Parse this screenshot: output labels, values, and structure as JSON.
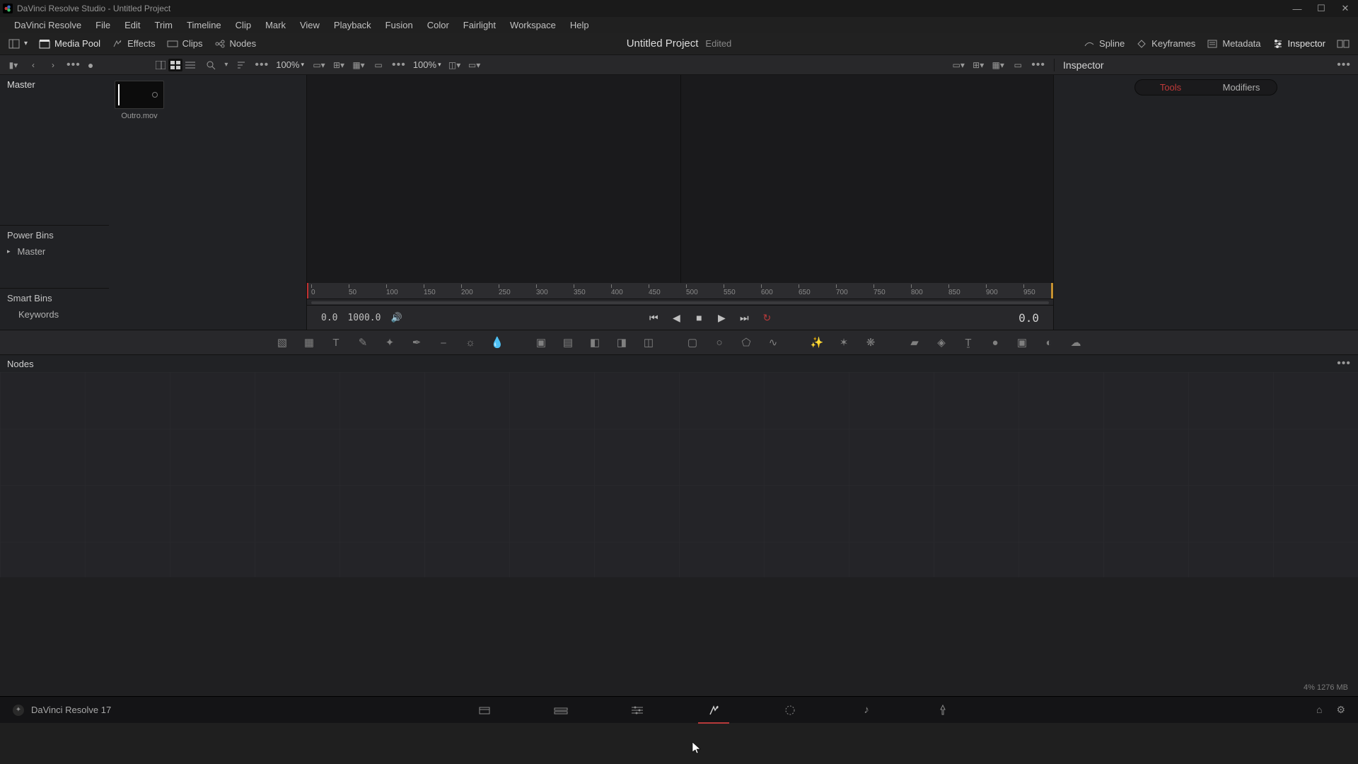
{
  "window_title": "DaVinci Resolve Studio - Untitled Project",
  "menu": [
    "DaVinci Resolve",
    "File",
    "Edit",
    "Trim",
    "Timeline",
    "Clip",
    "Mark",
    "View",
    "Playback",
    "Fusion",
    "Color",
    "Fairlight",
    "Workspace",
    "Help"
  ],
  "toolbar": {
    "media_pool": "Media Pool",
    "effects": "Effects",
    "clips": "Clips",
    "nodes": "Nodes",
    "spline": "Spline",
    "keyframes": "Keyframes",
    "metadata": "Metadata",
    "inspector": "Inspector"
  },
  "project_title": "Untitled Project",
  "project_status": "Edited",
  "zoom_left": "100%",
  "zoom_right": "100%",
  "inspector_label": "Inspector",
  "sidebar": {
    "master": "Master",
    "power_bins": "Power Bins",
    "power_master": "Master",
    "smart_bins": "Smart Bins",
    "keywords": "Keywords"
  },
  "clip_name": "Outro.mov",
  "transport": {
    "start": "0.0",
    "end": "1000.0",
    "current": "0.0"
  },
  "ruler_ticks": [
    "0",
    "50",
    "100",
    "150",
    "200",
    "250",
    "300",
    "350",
    "400",
    "450",
    "500",
    "550",
    "600",
    "650",
    "700",
    "750",
    "800",
    "850",
    "900",
    "950"
  ],
  "nodes_label": "Nodes",
  "insp_tabs": {
    "tools": "Tools",
    "modifiers": "Modifiers"
  },
  "footer_app": "DaVinci Resolve 17",
  "mem": "4%   1276 MB"
}
